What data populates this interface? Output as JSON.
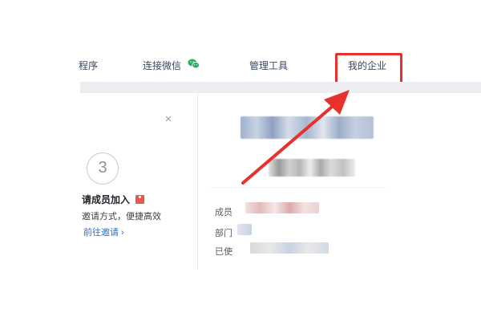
{
  "nav": {
    "items": [
      {
        "label": "程序"
      },
      {
        "label": "连接微信"
      },
      {
        "label": "管理工具"
      },
      {
        "label": "我的企业"
      }
    ]
  },
  "step": {
    "number": "3",
    "title": "请成员加入",
    "desc": "邀请方式，便捷高效",
    "link": "前往邀请 ›"
  },
  "profile": {
    "labels": [
      "成员",
      "部门",
      "已使"
    ]
  },
  "colors": {
    "highlight": "#e8312d",
    "wechat_green": "#2aae67",
    "link_blue": "#2a6fd1"
  }
}
